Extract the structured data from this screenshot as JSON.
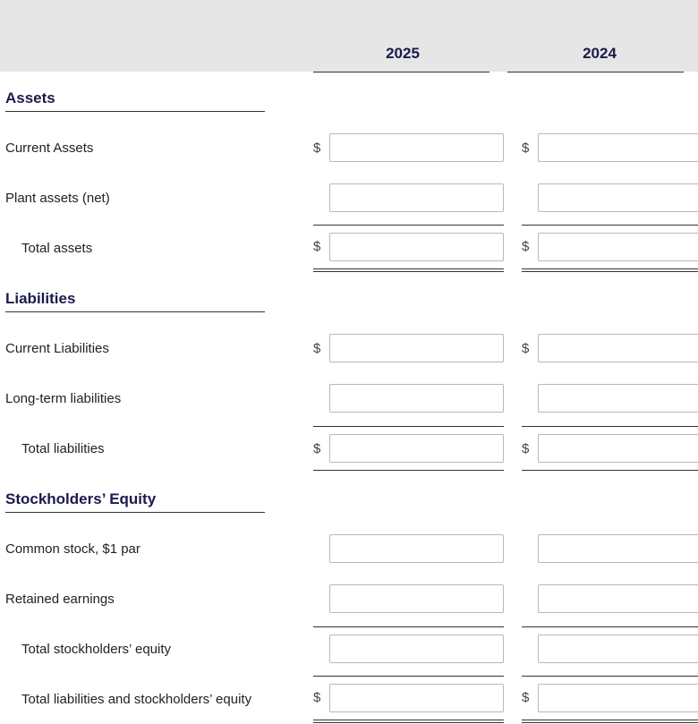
{
  "columns": {
    "year1": "2025",
    "year2": "2024"
  },
  "currency_symbol": "$",
  "sections": {
    "assets": {
      "title": "Assets",
      "rows": {
        "current_assets": {
          "label": "Current Assets",
          "currency": true,
          "v2025": "",
          "v2024": ""
        },
        "plant_assets": {
          "label": "Plant assets (net)",
          "currency": false,
          "v2025": "",
          "v2024": ""
        },
        "total_assets": {
          "label": "Total assets",
          "currency": true,
          "v2025": "",
          "v2024": ""
        }
      }
    },
    "liabilities": {
      "title": "Liabilities",
      "rows": {
        "current_liab": {
          "label": "Current Liabilities",
          "currency": true,
          "v2025": "",
          "v2024": ""
        },
        "lt_liab": {
          "label": "Long-term liabilities",
          "currency": false,
          "v2025": "",
          "v2024": ""
        },
        "total_liab": {
          "label": "Total liabilities",
          "currency": true,
          "v2025": "",
          "v2024": ""
        }
      }
    },
    "equity": {
      "title": "Stockholders’ Equity",
      "rows": {
        "common_stock": {
          "label": "Common stock, $1 par",
          "currency": false,
          "v2025": "",
          "v2024": ""
        },
        "retained": {
          "label": "Retained earnings",
          "currency": false,
          "v2025": "",
          "v2024": ""
        },
        "total_se": {
          "label": "Total stockholders’ equity",
          "currency": false,
          "v2025": "",
          "v2024": ""
        },
        "total_l_se": {
          "label": "Total liabilities and stockholders’ equity",
          "currency": true,
          "v2025": "",
          "v2024": ""
        }
      }
    }
  }
}
